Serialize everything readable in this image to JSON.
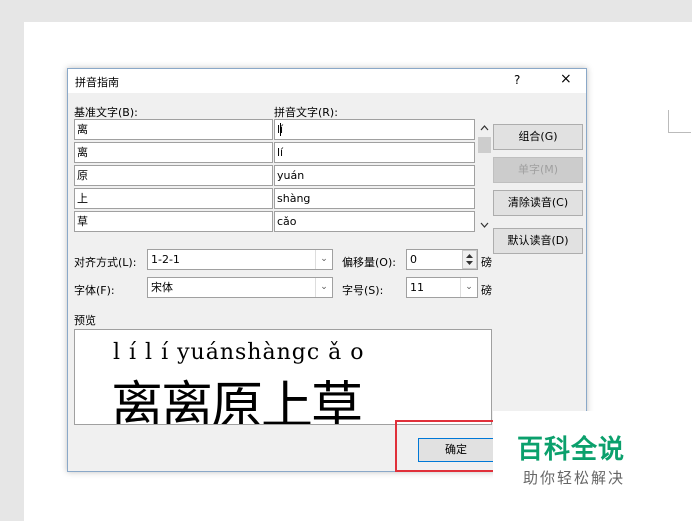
{
  "dialog": {
    "title": "拼音指南",
    "help_label": "?",
    "close_label": "×"
  },
  "labels": {
    "base_text": "基准文字(B):",
    "ruby_text": "拼音文字(R):",
    "alignment": "对齐方式(L):",
    "offset": "偏移量(O):",
    "font": "字体(F):",
    "size": "字号(S):",
    "preview": "预览",
    "pound": "磅"
  },
  "rows": [
    {
      "base": "离",
      "ruby": "lí"
    },
    {
      "base": "离",
      "ruby": "lí"
    },
    {
      "base": "原",
      "ruby": "yuán"
    },
    {
      "base": "上",
      "ruby": "shàng"
    },
    {
      "base": "草",
      "ruby": "cǎo"
    }
  ],
  "buttons": {
    "group": "组合(G)",
    "mono": "单字(M)",
    "clear": "清除读音(C)",
    "default": "默认读音(D)",
    "ok": "确定"
  },
  "fields": {
    "alignment": "1-2-1",
    "offset": "0",
    "font": "宋体",
    "size": "11"
  },
  "preview": {
    "pinyin": "l í  l í  yuánshàngc ǎ o",
    "chars": "离离原上草"
  },
  "watermark": {
    "title": "百科全说",
    "subtitle": "助你轻松解决"
  },
  "colors": {
    "brand": "#0ba06c",
    "highlight": "#e0303a"
  }
}
